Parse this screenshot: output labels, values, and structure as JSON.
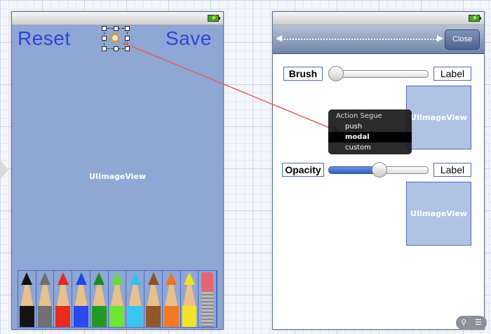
{
  "left_controller": {
    "reset_label": "Reset",
    "save_label": "Save",
    "image_view_label": "UIImageView",
    "pencils": [
      {
        "name": "black",
        "tip": "#111111",
        "body": "#141414"
      },
      {
        "name": "grey",
        "tip": "#6f6f6f",
        "body": "#707070"
      },
      {
        "name": "red",
        "tip": "#e32626",
        "body": "#ea2a1c"
      },
      {
        "name": "blue",
        "tip": "#2345e6",
        "body": "#2a49ef"
      },
      {
        "name": "dark-green",
        "tip": "#1f8a22",
        "body": "#229a24"
      },
      {
        "name": "light-green",
        "tip": "#64e02f",
        "body": "#6be632"
      },
      {
        "name": "light-blue",
        "tip": "#2fc1ef",
        "body": "#35c7f1"
      },
      {
        "name": "brown",
        "tip": "#8c5226",
        "body": "#925729"
      },
      {
        "name": "orange",
        "tip": "#f1731c",
        "body": "#f27a22"
      },
      {
        "name": "yellow",
        "tip": "#f3e21f",
        "body": "#f4e524"
      }
    ]
  },
  "right_controller": {
    "close_label": "Close",
    "brush_label": "Brush",
    "opacity_label": "Opacity",
    "value_label_1": "Label",
    "value_label_2": "Label",
    "image_view_1": "UIImageView",
    "image_view_2": "UIImageView",
    "brush_slider_value": 0.0,
    "opacity_slider_value": 0.5
  },
  "segue_menu": {
    "title": "Action Segue",
    "options": [
      "push",
      "modal",
      "custom"
    ],
    "selected": "modal"
  },
  "colors": {
    "segue_connection": "#e0655a",
    "canvas_background": "#8ea7d4",
    "button_text": "#2c45d8"
  }
}
